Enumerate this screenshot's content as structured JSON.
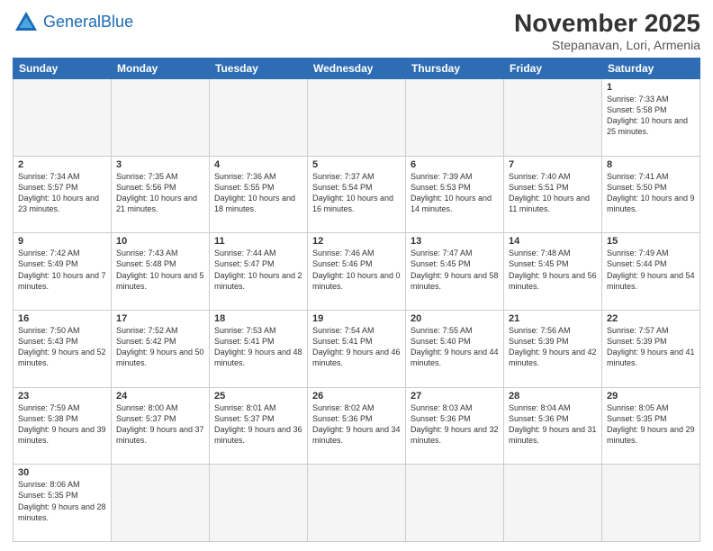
{
  "header": {
    "logo_general": "General",
    "logo_blue": "Blue",
    "title": "November 2025",
    "subtitle": "Stepanavan, Lori, Armenia"
  },
  "days_of_week": [
    "Sunday",
    "Monday",
    "Tuesday",
    "Wednesday",
    "Thursday",
    "Friday",
    "Saturday"
  ],
  "weeks": [
    [
      {
        "day": "",
        "info": ""
      },
      {
        "day": "",
        "info": ""
      },
      {
        "day": "",
        "info": ""
      },
      {
        "day": "",
        "info": ""
      },
      {
        "day": "",
        "info": ""
      },
      {
        "day": "",
        "info": ""
      },
      {
        "day": "1",
        "info": "Sunrise: 7:33 AM\nSunset: 5:58 PM\nDaylight: 10 hours and 25 minutes."
      }
    ],
    [
      {
        "day": "2",
        "info": "Sunrise: 7:34 AM\nSunset: 5:57 PM\nDaylight: 10 hours and 23 minutes."
      },
      {
        "day": "3",
        "info": "Sunrise: 7:35 AM\nSunset: 5:56 PM\nDaylight: 10 hours and 21 minutes."
      },
      {
        "day": "4",
        "info": "Sunrise: 7:36 AM\nSunset: 5:55 PM\nDaylight: 10 hours and 18 minutes."
      },
      {
        "day": "5",
        "info": "Sunrise: 7:37 AM\nSunset: 5:54 PM\nDaylight: 10 hours and 16 minutes."
      },
      {
        "day": "6",
        "info": "Sunrise: 7:39 AM\nSunset: 5:53 PM\nDaylight: 10 hours and 14 minutes."
      },
      {
        "day": "7",
        "info": "Sunrise: 7:40 AM\nSunset: 5:51 PM\nDaylight: 10 hours and 11 minutes."
      },
      {
        "day": "8",
        "info": "Sunrise: 7:41 AM\nSunset: 5:50 PM\nDaylight: 10 hours and 9 minutes."
      }
    ],
    [
      {
        "day": "9",
        "info": "Sunrise: 7:42 AM\nSunset: 5:49 PM\nDaylight: 10 hours and 7 minutes."
      },
      {
        "day": "10",
        "info": "Sunrise: 7:43 AM\nSunset: 5:48 PM\nDaylight: 10 hours and 5 minutes."
      },
      {
        "day": "11",
        "info": "Sunrise: 7:44 AM\nSunset: 5:47 PM\nDaylight: 10 hours and 2 minutes."
      },
      {
        "day": "12",
        "info": "Sunrise: 7:46 AM\nSunset: 5:46 PM\nDaylight: 10 hours and 0 minutes."
      },
      {
        "day": "13",
        "info": "Sunrise: 7:47 AM\nSunset: 5:45 PM\nDaylight: 9 hours and 58 minutes."
      },
      {
        "day": "14",
        "info": "Sunrise: 7:48 AM\nSunset: 5:45 PM\nDaylight: 9 hours and 56 minutes."
      },
      {
        "day": "15",
        "info": "Sunrise: 7:49 AM\nSunset: 5:44 PM\nDaylight: 9 hours and 54 minutes."
      }
    ],
    [
      {
        "day": "16",
        "info": "Sunrise: 7:50 AM\nSunset: 5:43 PM\nDaylight: 9 hours and 52 minutes."
      },
      {
        "day": "17",
        "info": "Sunrise: 7:52 AM\nSunset: 5:42 PM\nDaylight: 9 hours and 50 minutes."
      },
      {
        "day": "18",
        "info": "Sunrise: 7:53 AM\nSunset: 5:41 PM\nDaylight: 9 hours and 48 minutes."
      },
      {
        "day": "19",
        "info": "Sunrise: 7:54 AM\nSunset: 5:41 PM\nDaylight: 9 hours and 46 minutes."
      },
      {
        "day": "20",
        "info": "Sunrise: 7:55 AM\nSunset: 5:40 PM\nDaylight: 9 hours and 44 minutes."
      },
      {
        "day": "21",
        "info": "Sunrise: 7:56 AM\nSunset: 5:39 PM\nDaylight: 9 hours and 42 minutes."
      },
      {
        "day": "22",
        "info": "Sunrise: 7:57 AM\nSunset: 5:39 PM\nDaylight: 9 hours and 41 minutes."
      }
    ],
    [
      {
        "day": "23",
        "info": "Sunrise: 7:59 AM\nSunset: 5:38 PM\nDaylight: 9 hours and 39 minutes."
      },
      {
        "day": "24",
        "info": "Sunrise: 8:00 AM\nSunset: 5:37 PM\nDaylight: 9 hours and 37 minutes."
      },
      {
        "day": "25",
        "info": "Sunrise: 8:01 AM\nSunset: 5:37 PM\nDaylight: 9 hours and 36 minutes."
      },
      {
        "day": "26",
        "info": "Sunrise: 8:02 AM\nSunset: 5:36 PM\nDaylight: 9 hours and 34 minutes."
      },
      {
        "day": "27",
        "info": "Sunrise: 8:03 AM\nSunset: 5:36 PM\nDaylight: 9 hours and 32 minutes."
      },
      {
        "day": "28",
        "info": "Sunrise: 8:04 AM\nSunset: 5:36 PM\nDaylight: 9 hours and 31 minutes."
      },
      {
        "day": "29",
        "info": "Sunrise: 8:05 AM\nSunset: 5:35 PM\nDaylight: 9 hours and 29 minutes."
      }
    ],
    [
      {
        "day": "30",
        "info": "Sunrise: 8:06 AM\nSunset: 5:35 PM\nDaylight: 9 hours and 28 minutes."
      },
      {
        "day": "",
        "info": ""
      },
      {
        "day": "",
        "info": ""
      },
      {
        "day": "",
        "info": ""
      },
      {
        "day": "",
        "info": ""
      },
      {
        "day": "",
        "info": ""
      },
      {
        "day": "",
        "info": ""
      }
    ]
  ]
}
